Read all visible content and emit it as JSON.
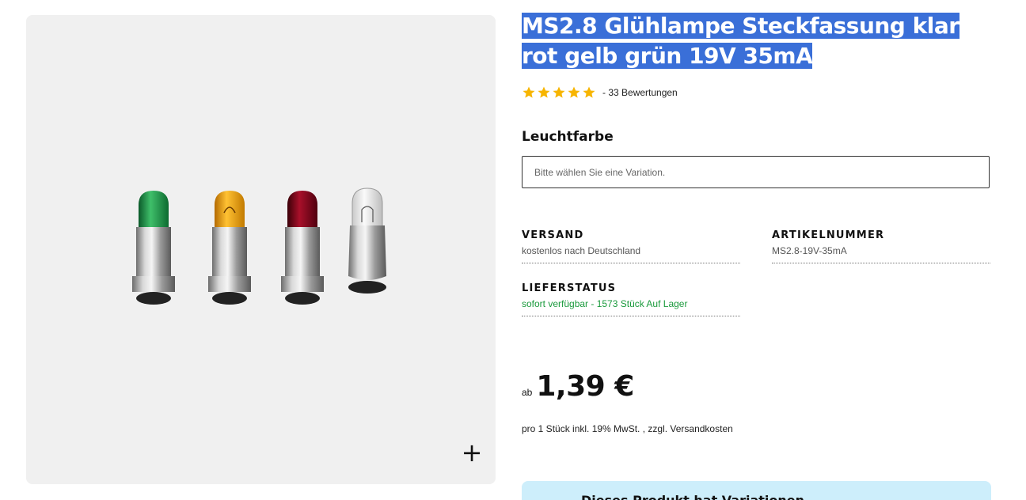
{
  "product": {
    "title": "MS2.8 Glühlampe Steckfassung klar rot gelb grün 19V 35mA",
    "rating": 5,
    "rating_count_text": "- 33 Bewertungen",
    "image_alt": "MS2.8 Glühlampen grün gelb rot klar"
  },
  "options": {
    "label": "Leuchtfarbe",
    "placeholder": "Bitte wählen Sie eine Variation."
  },
  "meta": {
    "shipping_label": "VERSAND",
    "shipping_value": "kostenlos nach Deutschland",
    "sku_label": "ARTIKELNUMMER",
    "sku_value": "MS2.8-19V-35mA",
    "stock_label": "LIEFERSTATUS",
    "stock_value": "sofort verfügbar - 1573 Stück Auf Lager"
  },
  "pricing": {
    "prefix": "ab",
    "price": "1,39 €",
    "note": "pro 1 Stück inkl. 19% MwSt. , zzgl. Versandkosten"
  },
  "variation_notice": {
    "text": "Dieses Produkt hat Variationen"
  },
  "gallery": {
    "zoom_symbol": "+"
  },
  "colors": {
    "title_highlight": "#3a6fd8",
    "star": "#f7b500",
    "stock_green": "#1a9a3c",
    "notice_bg": "#cdeefb",
    "gallery_bg": "#f0f0f0"
  }
}
